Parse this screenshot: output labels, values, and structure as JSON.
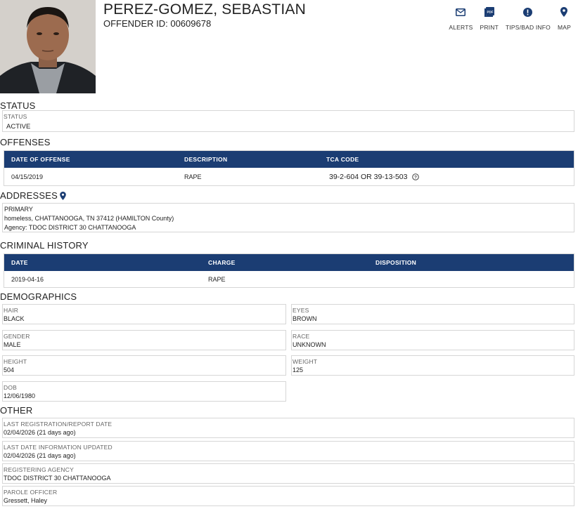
{
  "header": {
    "name": "PEREZ-GOMEZ, SEBASTIAN",
    "offender_id": "OFFENDER ID: 00609678",
    "actions": [
      {
        "label": "ALERTS",
        "icon": "envelope-icon"
      },
      {
        "label": "PRINT",
        "icon": "pdf-icon"
      },
      {
        "label": "TIPS/BAD INFO",
        "icon": "alert-icon"
      },
      {
        "label": "MAP",
        "icon": "map-pin-icon"
      }
    ]
  },
  "status": {
    "section_title": "STATUS",
    "label": "STATUS",
    "value": "ACTIVE"
  },
  "offenses": {
    "section_title": "OFFENSES",
    "columns": [
      "DATE OF OFFENSE",
      "DESCRIPTION",
      "TCA CODE"
    ],
    "rows": [
      {
        "date": "04/15/2019",
        "description": "RAPE",
        "tca_code": "39-2-604 OR 39-13-503"
      }
    ]
  },
  "addresses": {
    "section_title": "ADDRESSES",
    "type": "PRIMARY",
    "address": "homeless, CHATTANOOGA, TN 37412 (HAMILTON County)",
    "agency": "Agency: TDOC DISTRICT 30 CHATTANOOGA"
  },
  "criminal_history": {
    "section_title": "CRIMINAL HISTORY",
    "columns": [
      "DATE",
      "CHARGE",
      "DISPOSITION"
    ],
    "rows": [
      {
        "date": "2019-04-16",
        "charge": "RAPE",
        "disposition": ""
      }
    ]
  },
  "demographics": {
    "section_title": "DEMOGRAPHICS",
    "hair": {
      "label": "HAIR",
      "value": "BLACK"
    },
    "eyes": {
      "label": "EYES",
      "value": "BROWN"
    },
    "gender": {
      "label": "GENDER",
      "value": "MALE"
    },
    "race": {
      "label": "RACE",
      "value": "UNKNOWN"
    },
    "height": {
      "label": "HEIGHT",
      "value": "504"
    },
    "weight": {
      "label": "WEIGHT",
      "value": "125"
    },
    "dob": {
      "label": "DOB",
      "value": "12/06/1980"
    }
  },
  "other": {
    "section_title": "OTHER",
    "last_registration": {
      "label": "LAST REGISTRATION/REPORT DATE",
      "value": "02/04/2026 (21 days ago)"
    },
    "last_updated": {
      "label": "LAST DATE INFORMATION UPDATED",
      "value": "02/04/2026 (21 days ago)"
    },
    "registering_agency": {
      "label": "REGISTERING AGENCY",
      "value": "TDOC DISTRICT 30 CHATTANOOGA"
    },
    "parole_officer": {
      "label": "PAROLE OFFICER",
      "value": "Gressett, Haley"
    }
  },
  "colors": {
    "table_header": "#1b3d73",
    "icon": "#1b3d73"
  }
}
